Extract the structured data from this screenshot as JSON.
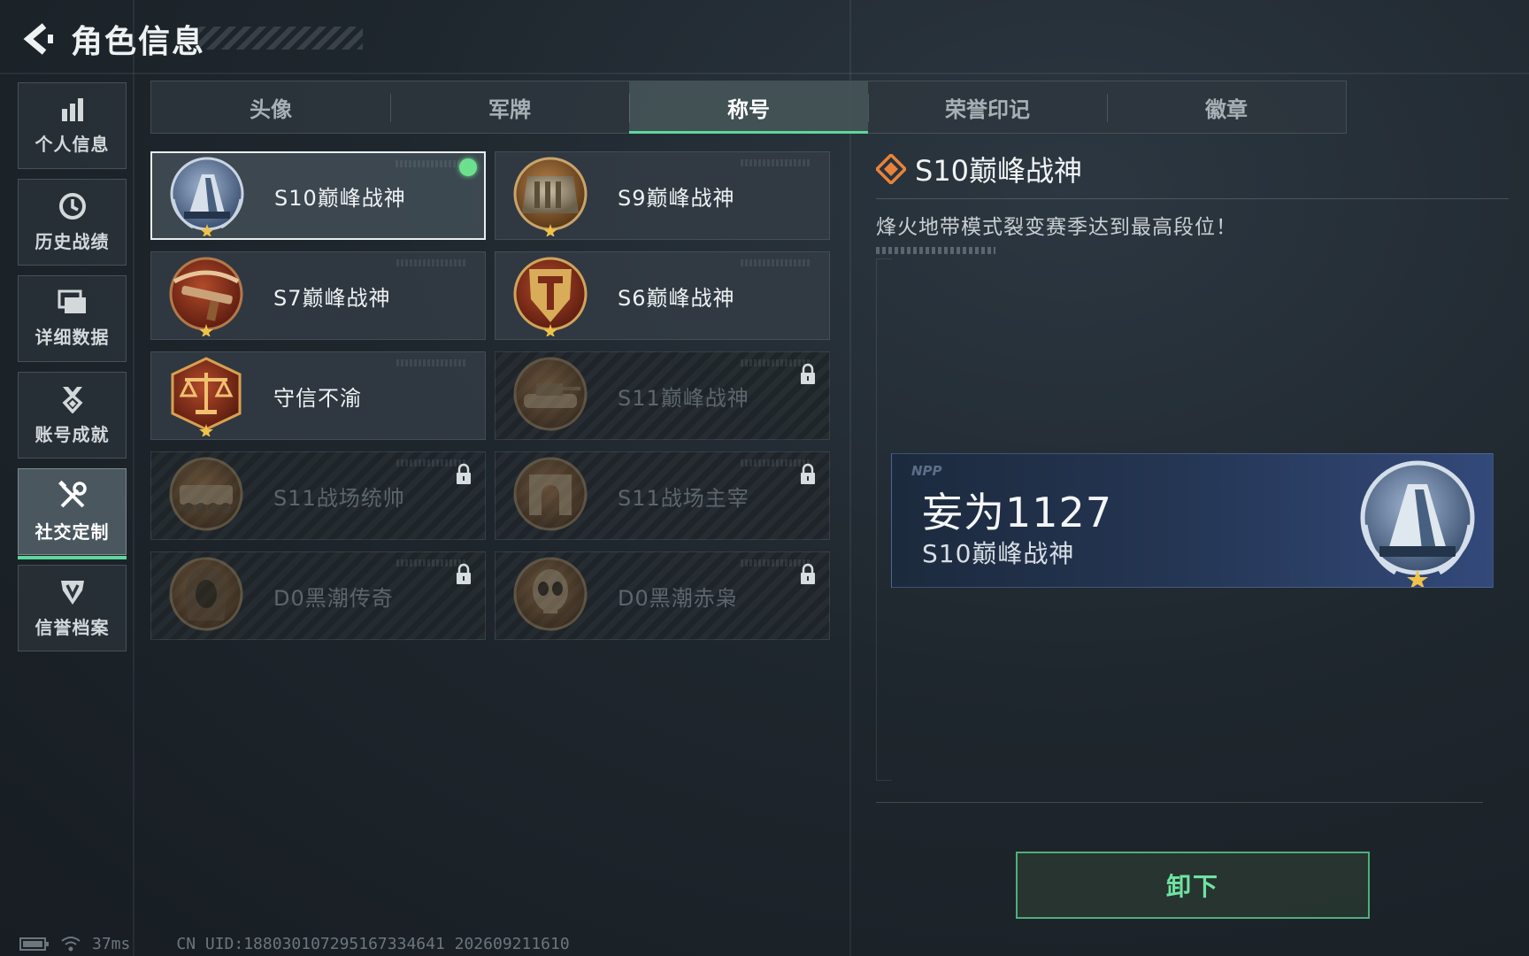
{
  "header": {
    "title": "角色信息"
  },
  "sidebar": {
    "items": [
      {
        "label": "个人信息",
        "icon": "bar-chart-icon",
        "active": false
      },
      {
        "label": "历史战绩",
        "icon": "clock-icon",
        "active": false
      },
      {
        "label": "详细数据",
        "icon": "folders-icon",
        "active": false
      },
      {
        "label": "账号成就",
        "icon": "medal-icon",
        "active": false
      },
      {
        "label": "社交定制",
        "icon": "tools-icon",
        "active": true
      },
      {
        "label": "信誉档案",
        "icon": "shield-v-icon",
        "active": false
      }
    ]
  },
  "tabs": [
    {
      "label": "头像",
      "active": false
    },
    {
      "label": "军牌",
      "active": false
    },
    {
      "label": "称号",
      "active": true
    },
    {
      "label": "荣誉印记",
      "active": false
    },
    {
      "label": "徽章",
      "active": false
    }
  ],
  "titles": [
    {
      "name": "S10巅峰战神",
      "locked": false,
      "selected": true,
      "equipped": true,
      "emblem": "mountain-emblem-icon"
    },
    {
      "name": "S9巅峰战神",
      "locked": false,
      "selected": false,
      "equipped": false,
      "emblem": "dam-emblem-icon"
    },
    {
      "name": "S7巅峰战神",
      "locked": false,
      "selected": false,
      "equipped": false,
      "emblem": "crossbow-emblem-icon"
    },
    {
      "name": "S6巅峰战神",
      "locked": false,
      "selected": false,
      "equipped": false,
      "emblem": "shield-t-emblem-icon"
    },
    {
      "name": "守信不渝",
      "locked": false,
      "selected": false,
      "equipped": false,
      "emblem": "scales-emblem-icon"
    },
    {
      "name": "S11巅峰战神",
      "locked": true,
      "selected": false,
      "equipped": false,
      "emblem": "tank-emblem-icon"
    },
    {
      "name": "S11战场统帅",
      "locked": true,
      "selected": false,
      "equipped": false,
      "emblem": "vehicle-emblem-icon"
    },
    {
      "name": "S11战场主宰",
      "locked": true,
      "selected": false,
      "equipped": false,
      "emblem": "arch-emblem-icon"
    },
    {
      "name": "D0黑潮传奇",
      "locked": true,
      "selected": false,
      "equipped": false,
      "emblem": "hooded-emblem-icon"
    },
    {
      "name": "D0黑潮赤枭",
      "locked": true,
      "selected": false,
      "equipped": false,
      "emblem": "skull-emblem-icon"
    }
  ],
  "detail": {
    "title": "S10巅峰战神",
    "description": "烽火地带模式裂变赛季达到最高段位！"
  },
  "preview": {
    "tag": "NPP",
    "player_name": "妄为1127",
    "title": "S10巅峰战神"
  },
  "actions": {
    "unequip_label": "卸下"
  },
  "status": {
    "ping": "37ms",
    "uid": "CN UID:1880301072951673346​41 202609211610"
  },
  "colors": {
    "accent_green": "#5fd69e",
    "equipped_dot": "#6be08f",
    "emblem_bronze": "#8a5a2e",
    "emblem_steel": "#6f87a8"
  }
}
